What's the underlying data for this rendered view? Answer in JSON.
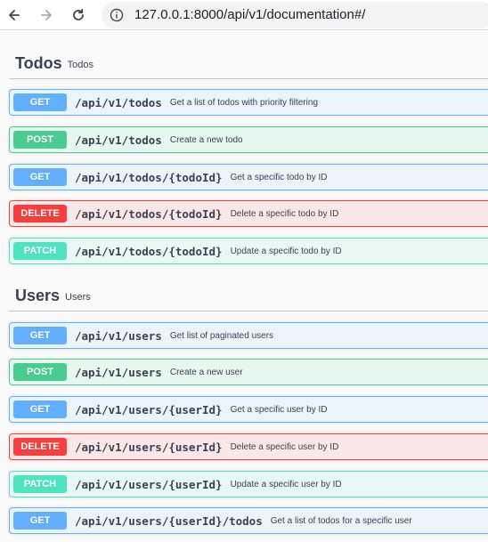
{
  "browser": {
    "url": "127.0.0.1:8000/api/v1/documentation#/"
  },
  "sections": [
    {
      "name": "Todos",
      "description": "Todos",
      "operations": [
        {
          "method": "GET",
          "path": "/api/v1/todos",
          "summary": "Get a list of todos with priority filtering"
        },
        {
          "method": "POST",
          "path": "/api/v1/todos",
          "summary": "Create a new todo"
        },
        {
          "method": "GET",
          "path": "/api/v1/todos/{todoId}",
          "summary": "Get a specific todo by ID"
        },
        {
          "method": "DELETE",
          "path": "/api/v1/todos/{todoId}",
          "summary": "Delete a specific todo by ID"
        },
        {
          "method": "PATCH",
          "path": "/api/v1/todos/{todoId}",
          "summary": "Update a specific todo by ID"
        }
      ]
    },
    {
      "name": "Users",
      "description": "Users",
      "operations": [
        {
          "method": "GET",
          "path": "/api/v1/users",
          "summary": "Get list of paginated users"
        },
        {
          "method": "POST",
          "path": "/api/v1/users",
          "summary": "Create a new user"
        },
        {
          "method": "GET",
          "path": "/api/v1/users/{userId}",
          "summary": "Get a specific user by ID"
        },
        {
          "method": "DELETE",
          "path": "/api/v1/users/{userId}",
          "summary": "Delete a specific user by ID"
        },
        {
          "method": "PATCH",
          "path": "/api/v1/users/{userId}",
          "summary": "Update a specific user by ID"
        },
        {
          "method": "GET",
          "path": "/api/v1/users/{userId}/todos",
          "summary": "Get a list of todos for a specific user"
        }
      ]
    }
  ],
  "colors": {
    "get": "#61affe",
    "post": "#49cc90",
    "delete": "#f93e3e",
    "patch": "#50e3c2"
  }
}
